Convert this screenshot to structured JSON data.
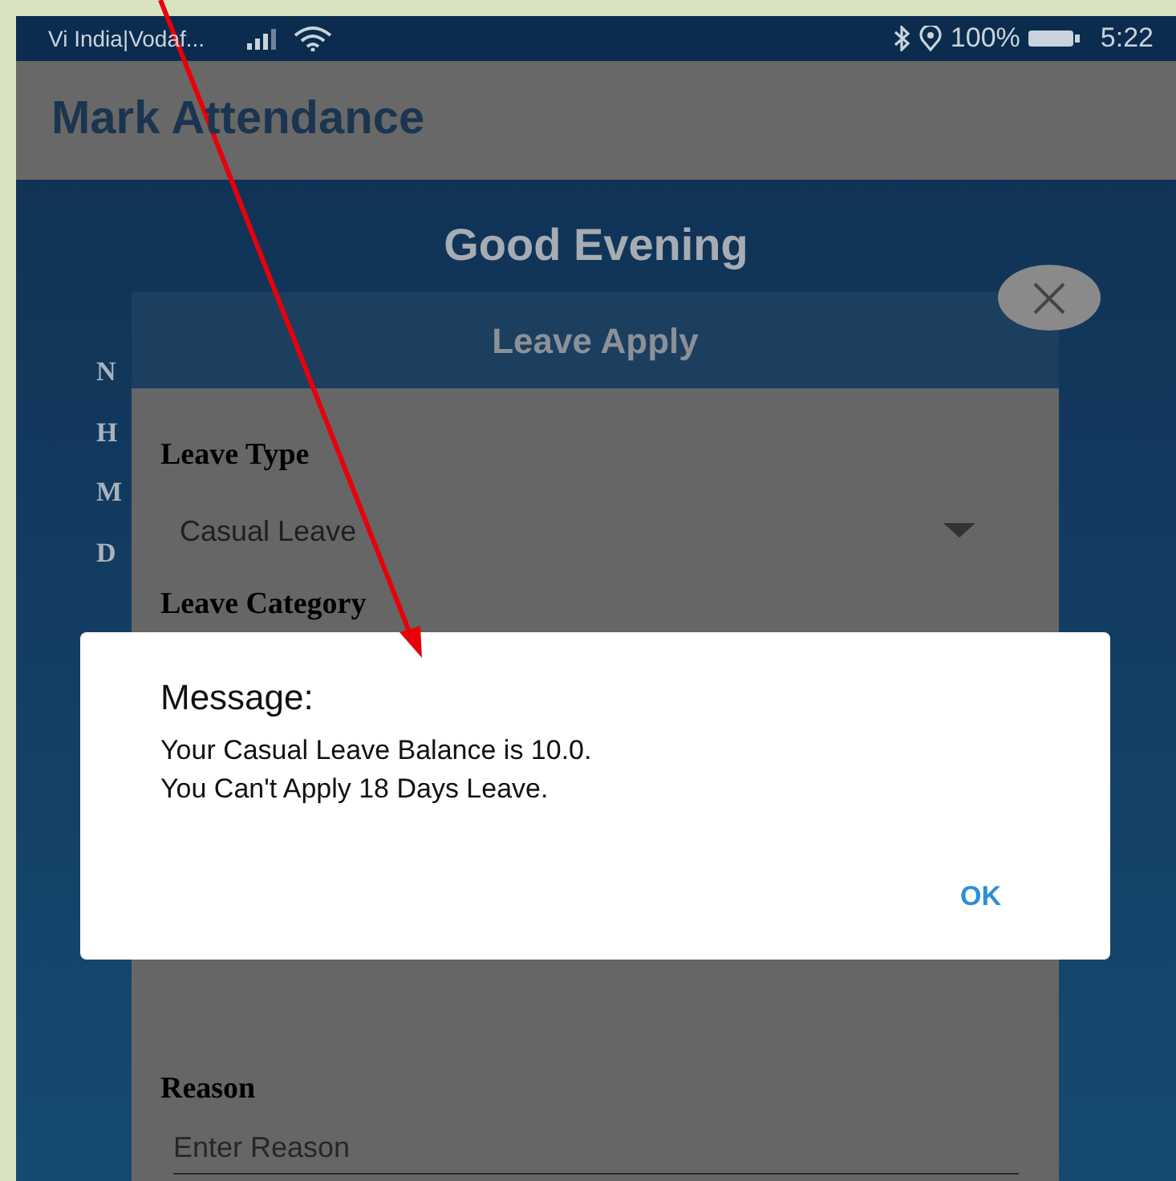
{
  "status_bar": {
    "carrier": "Vi India|Vodaf...",
    "battery": "100%",
    "time": "5:22"
  },
  "app_bar": {
    "title": "Mark Attendance"
  },
  "greeting": "Good Evening",
  "profile_labels": [
    "N",
    "H",
    "M",
    "D"
  ],
  "leave_form": {
    "title": "Leave Apply",
    "fields": [
      {
        "kind": "select",
        "label": "Leave Type",
        "value": "Casual Leave"
      },
      {
        "kind": "label",
        "label": "Leave Category"
      },
      {
        "kind": "text",
        "label": "Reason",
        "placeholder": "Enter Reason"
      }
    ]
  },
  "message_dialog": {
    "title": "Message:",
    "text": "Your Casual Leave Balance is 10.0.\n You Can't Apply 18 Days Leave.",
    "buttons": [
      "OK"
    ]
  }
}
